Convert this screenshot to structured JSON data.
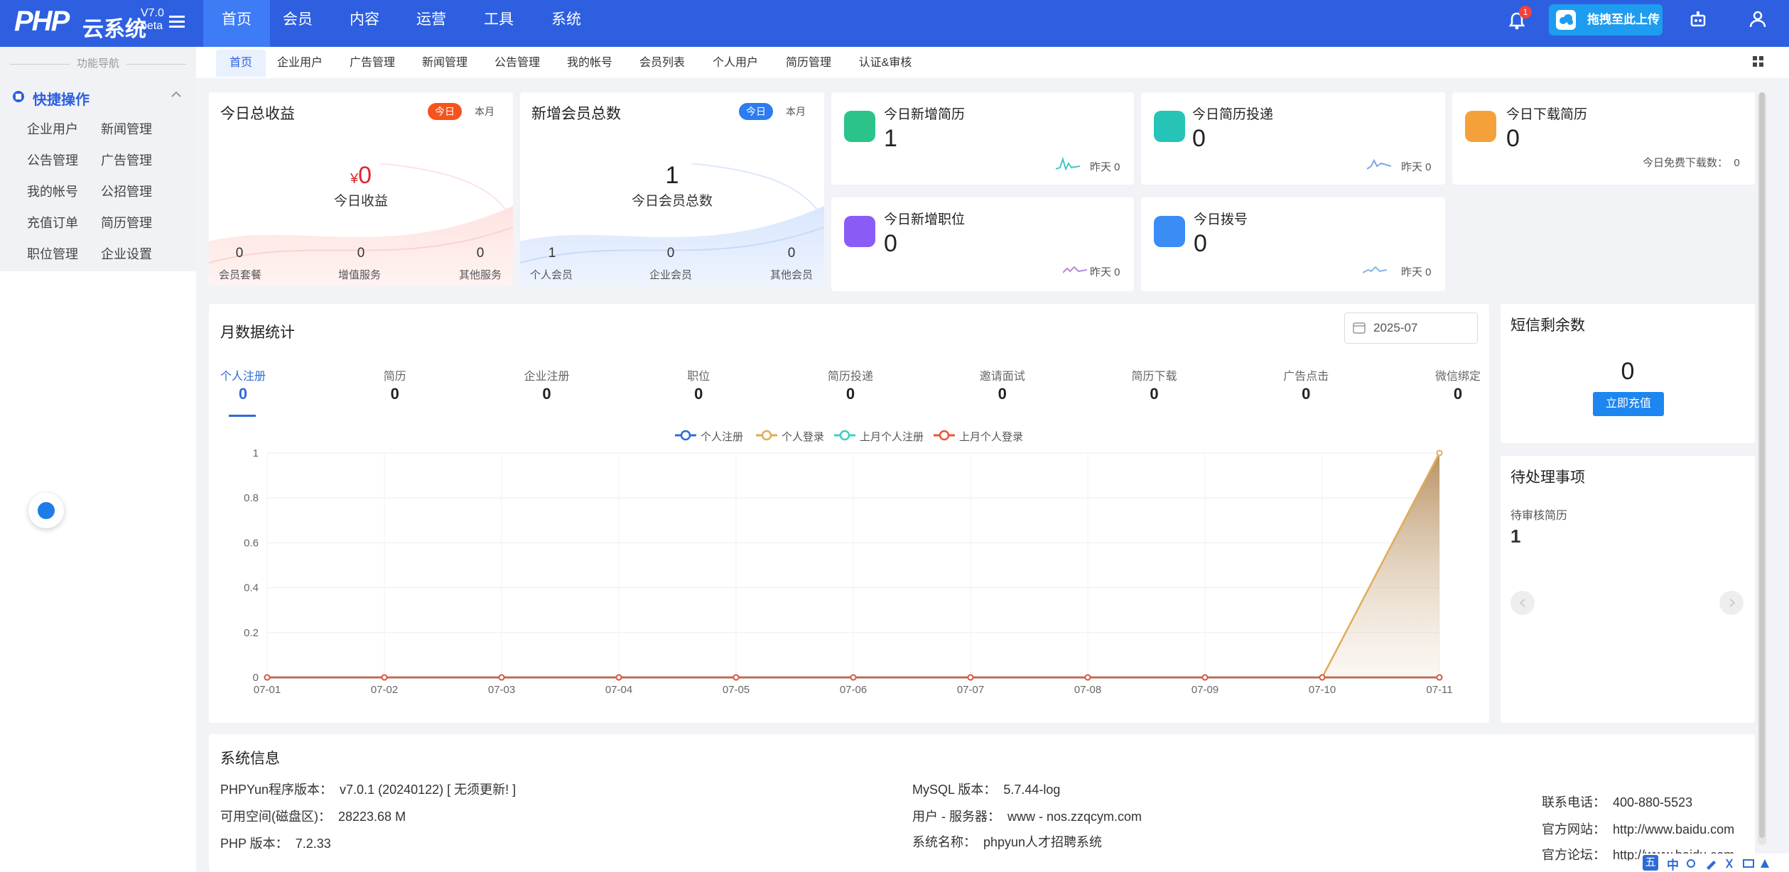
{
  "header": {
    "logo_main": "PHP",
    "logo_sub": "云系统",
    "logo_version": "V7.0",
    "logo_beta": "beta",
    "nav": [
      "首页",
      "会员",
      "内容",
      "运营",
      "工具",
      "系统"
    ],
    "bell_count": "1",
    "upload_label": "拖拽至此上传"
  },
  "sidebar": {
    "nav_label": "功能导航",
    "quick_title": "快捷操作",
    "links": [
      "企业用户",
      "新闻管理",
      "公告管理",
      "广告管理",
      "我的帐号",
      "公招管理",
      "充值订单",
      "简历管理",
      "职位管理",
      "企业设置"
    ]
  },
  "tabs": [
    "首页",
    "企业用户",
    "广告管理",
    "新闻管理",
    "公告管理",
    "我的帐号",
    "会员列表",
    "个人用户",
    "简历管理",
    "认证&审核"
  ],
  "revenue": {
    "title": "今日总收益",
    "today": "今日",
    "month": "本月",
    "currency": "¥",
    "value": "0",
    "label": "今日收益",
    "stats": [
      {
        "value": "0",
        "label": "会员套餐"
      },
      {
        "value": "0",
        "label": "增值服务"
      },
      {
        "value": "0",
        "label": "其他服务"
      }
    ]
  },
  "members": {
    "title": "新增会员总数",
    "today": "今日",
    "month": "本月",
    "value": "1",
    "label": "今日会员总数",
    "stats": [
      {
        "value": "1",
        "label": "个人会员"
      },
      {
        "value": "0",
        "label": "企业会员"
      },
      {
        "value": "0",
        "label": "其他会员"
      }
    ]
  },
  "stats_cards": [
    {
      "title": "今日新增简历",
      "value": "1",
      "foot": "昨天 0",
      "color": "#2bc38a",
      "spark": "#44c9c1"
    },
    {
      "title": "今日简历投递",
      "value": "0",
      "foot": "昨天 0",
      "color": "#25c4b6",
      "spark": "#7fa8e8"
    },
    {
      "title": "今日下载简历",
      "value": "0",
      "foot": "今日免费下载数：  0",
      "color": "#f5a13a",
      "spark": ""
    },
    {
      "title": "今日新增职位",
      "value": "0",
      "foot": "昨天 0",
      "color": "#8a5cf5",
      "spark": "#b58ad9"
    },
    {
      "title": "今日拨号",
      "value": "0",
      "foot": "昨天 0",
      "color": "#3a8df5",
      "spark": "#7fb6e8"
    }
  ],
  "monthly": {
    "title": "月数据统计",
    "date": "2025-07",
    "metrics": [
      {
        "label": "个人注册",
        "value": "0"
      },
      {
        "label": "简历",
        "value": "0"
      },
      {
        "label": "企业注册",
        "value": "0"
      },
      {
        "label": "职位",
        "value": "0"
      },
      {
        "label": "简历投递",
        "value": "0"
      },
      {
        "label": "邀请面试",
        "value": "0"
      },
      {
        "label": "简历下载",
        "value": "0"
      },
      {
        "label": "广告点击",
        "value": "0"
      },
      {
        "label": "微信绑定",
        "value": "0"
      }
    ]
  },
  "chart_data": {
    "type": "line",
    "x": [
      "07-01",
      "07-02",
      "07-03",
      "07-04",
      "07-05",
      "07-06",
      "07-07",
      "07-08",
      "07-09",
      "07-10",
      "07-11"
    ],
    "y_ticks": [
      "0",
      "0.2",
      "0.4",
      "0.6",
      "0.8",
      "1"
    ],
    "ylim": [
      0,
      1
    ],
    "grid": true,
    "legend": "top-center",
    "series": [
      {
        "name": "个人注册",
        "color": "#2d6bd6",
        "values": [
          0,
          0,
          0,
          0,
          0,
          0,
          0,
          0,
          0,
          0,
          0
        ]
      },
      {
        "name": "个人登录",
        "color": "#e0ac5a",
        "values": [
          0,
          0,
          0,
          0,
          0,
          0,
          0,
          0,
          0,
          0,
          1
        ]
      },
      {
        "name": "上月个人注册",
        "color": "#3ecfc0",
        "values": [
          0,
          0,
          0,
          0,
          0,
          0,
          0,
          0,
          0,
          0,
          0
        ]
      },
      {
        "name": "上月个人登录",
        "color": "#e8563a",
        "values": [
          0,
          0,
          0,
          0,
          0,
          0,
          0,
          0,
          0,
          0,
          0
        ]
      }
    ]
  },
  "sms": {
    "title": "短信剩余数",
    "value": "0",
    "button": "立即充值"
  },
  "pending": {
    "title": "待处理事项",
    "label": "待审核简历",
    "value": "1"
  },
  "sysinfo": {
    "title": "系统信息",
    "col1": [
      "PHPYun程序版本：  v7.0.1 (20240122) [ 无须更新! ]",
      "可用空间(磁盘区)：  28223.68 M",
      "PHP 版本：  7.2.33"
    ],
    "col2": [
      "MySQL 版本：  5.7.44-log",
      "用户 - 服务器：  www - nos.zzqcym.com",
      "系统名称：  phpyun人才招聘系统"
    ],
    "col3": [
      "联系电话：  400-880-5523",
      "官方网站：  http://www.baidu.com",
      "官方论坛：  http://www.baidu.com/bbs"
    ]
  },
  "ime": {
    "label1": "五",
    "label2": "中"
  }
}
